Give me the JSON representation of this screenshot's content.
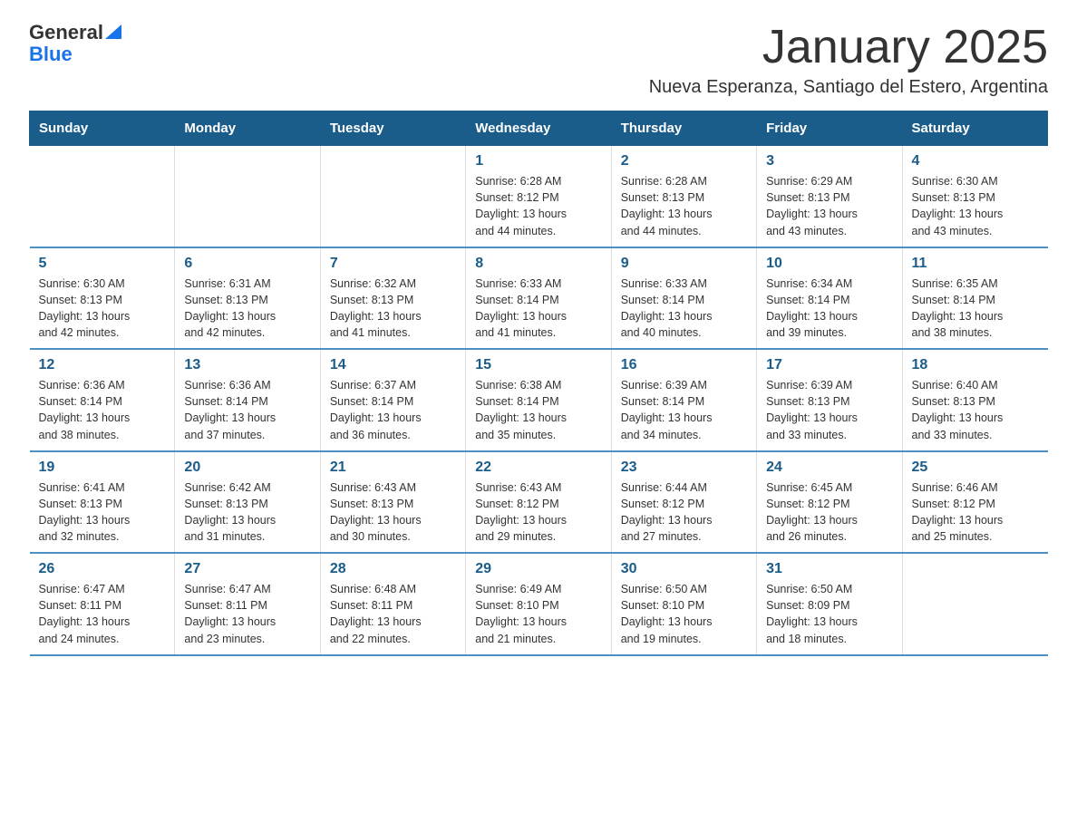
{
  "logo": {
    "text_general": "General",
    "text_blue": "Blue"
  },
  "title": "January 2025",
  "subtitle": "Nueva Esperanza, Santiago del Estero, Argentina",
  "header_color": "#1a5c8a",
  "days_of_week": [
    "Sunday",
    "Monday",
    "Tuesday",
    "Wednesday",
    "Thursday",
    "Friday",
    "Saturday"
  ],
  "weeks": [
    [
      {
        "day": "",
        "info": ""
      },
      {
        "day": "",
        "info": ""
      },
      {
        "day": "",
        "info": ""
      },
      {
        "day": "1",
        "info": "Sunrise: 6:28 AM\nSunset: 8:12 PM\nDaylight: 13 hours\nand 44 minutes."
      },
      {
        "day": "2",
        "info": "Sunrise: 6:28 AM\nSunset: 8:13 PM\nDaylight: 13 hours\nand 44 minutes."
      },
      {
        "day": "3",
        "info": "Sunrise: 6:29 AM\nSunset: 8:13 PM\nDaylight: 13 hours\nand 43 minutes."
      },
      {
        "day": "4",
        "info": "Sunrise: 6:30 AM\nSunset: 8:13 PM\nDaylight: 13 hours\nand 43 minutes."
      }
    ],
    [
      {
        "day": "5",
        "info": "Sunrise: 6:30 AM\nSunset: 8:13 PM\nDaylight: 13 hours\nand 42 minutes."
      },
      {
        "day": "6",
        "info": "Sunrise: 6:31 AM\nSunset: 8:13 PM\nDaylight: 13 hours\nand 42 minutes."
      },
      {
        "day": "7",
        "info": "Sunrise: 6:32 AM\nSunset: 8:13 PM\nDaylight: 13 hours\nand 41 minutes."
      },
      {
        "day": "8",
        "info": "Sunrise: 6:33 AM\nSunset: 8:14 PM\nDaylight: 13 hours\nand 41 minutes."
      },
      {
        "day": "9",
        "info": "Sunrise: 6:33 AM\nSunset: 8:14 PM\nDaylight: 13 hours\nand 40 minutes."
      },
      {
        "day": "10",
        "info": "Sunrise: 6:34 AM\nSunset: 8:14 PM\nDaylight: 13 hours\nand 39 minutes."
      },
      {
        "day": "11",
        "info": "Sunrise: 6:35 AM\nSunset: 8:14 PM\nDaylight: 13 hours\nand 38 minutes."
      }
    ],
    [
      {
        "day": "12",
        "info": "Sunrise: 6:36 AM\nSunset: 8:14 PM\nDaylight: 13 hours\nand 38 minutes."
      },
      {
        "day": "13",
        "info": "Sunrise: 6:36 AM\nSunset: 8:14 PM\nDaylight: 13 hours\nand 37 minutes."
      },
      {
        "day": "14",
        "info": "Sunrise: 6:37 AM\nSunset: 8:14 PM\nDaylight: 13 hours\nand 36 minutes."
      },
      {
        "day": "15",
        "info": "Sunrise: 6:38 AM\nSunset: 8:14 PM\nDaylight: 13 hours\nand 35 minutes."
      },
      {
        "day": "16",
        "info": "Sunrise: 6:39 AM\nSunset: 8:14 PM\nDaylight: 13 hours\nand 34 minutes."
      },
      {
        "day": "17",
        "info": "Sunrise: 6:39 AM\nSunset: 8:13 PM\nDaylight: 13 hours\nand 33 minutes."
      },
      {
        "day": "18",
        "info": "Sunrise: 6:40 AM\nSunset: 8:13 PM\nDaylight: 13 hours\nand 33 minutes."
      }
    ],
    [
      {
        "day": "19",
        "info": "Sunrise: 6:41 AM\nSunset: 8:13 PM\nDaylight: 13 hours\nand 32 minutes."
      },
      {
        "day": "20",
        "info": "Sunrise: 6:42 AM\nSunset: 8:13 PM\nDaylight: 13 hours\nand 31 minutes."
      },
      {
        "day": "21",
        "info": "Sunrise: 6:43 AM\nSunset: 8:13 PM\nDaylight: 13 hours\nand 30 minutes."
      },
      {
        "day": "22",
        "info": "Sunrise: 6:43 AM\nSunset: 8:12 PM\nDaylight: 13 hours\nand 29 minutes."
      },
      {
        "day": "23",
        "info": "Sunrise: 6:44 AM\nSunset: 8:12 PM\nDaylight: 13 hours\nand 27 minutes."
      },
      {
        "day": "24",
        "info": "Sunrise: 6:45 AM\nSunset: 8:12 PM\nDaylight: 13 hours\nand 26 minutes."
      },
      {
        "day": "25",
        "info": "Sunrise: 6:46 AM\nSunset: 8:12 PM\nDaylight: 13 hours\nand 25 minutes."
      }
    ],
    [
      {
        "day": "26",
        "info": "Sunrise: 6:47 AM\nSunset: 8:11 PM\nDaylight: 13 hours\nand 24 minutes."
      },
      {
        "day": "27",
        "info": "Sunrise: 6:47 AM\nSunset: 8:11 PM\nDaylight: 13 hours\nand 23 minutes."
      },
      {
        "day": "28",
        "info": "Sunrise: 6:48 AM\nSunset: 8:11 PM\nDaylight: 13 hours\nand 22 minutes."
      },
      {
        "day": "29",
        "info": "Sunrise: 6:49 AM\nSunset: 8:10 PM\nDaylight: 13 hours\nand 21 minutes."
      },
      {
        "day": "30",
        "info": "Sunrise: 6:50 AM\nSunset: 8:10 PM\nDaylight: 13 hours\nand 19 minutes."
      },
      {
        "day": "31",
        "info": "Sunrise: 6:50 AM\nSunset: 8:09 PM\nDaylight: 13 hours\nand 18 minutes."
      },
      {
        "day": "",
        "info": ""
      }
    ]
  ]
}
